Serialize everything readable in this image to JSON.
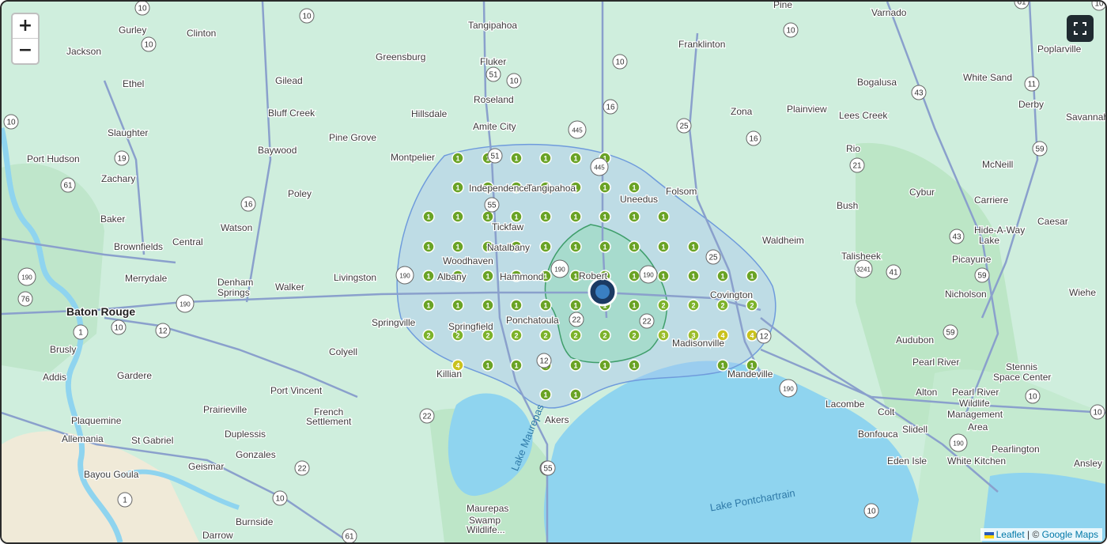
{
  "controls": {
    "zoom_in": "+",
    "zoom_out": "−",
    "fullscreen_icon": "fullscreen-icon"
  },
  "attribution": {
    "leaflet": "Leaflet",
    "separator": " | © ",
    "provider": "Google Maps"
  },
  "colors": {
    "land": "#cfeedd",
    "water": "#8fd4ef",
    "road": "#8aa0cc",
    "outer_zone": "#a9c6ef",
    "inner_zone": "#7fd9a0",
    "marker": "#6aa325"
  },
  "places": [
    {
      "name": "Gurley",
      "bold": false
    },
    {
      "name": "Clinton",
      "bold": false
    },
    {
      "name": "Jackson",
      "bold": false
    },
    {
      "name": "Tangipahoa",
      "bold": false
    },
    {
      "name": "Pine",
      "bold": false
    },
    {
      "name": "Varnado",
      "bold": false
    },
    {
      "name": "Greensburg",
      "bold": false
    },
    {
      "name": "Fluker",
      "bold": false
    },
    {
      "name": "Franklinton",
      "bold": false
    },
    {
      "name": "Poplarville",
      "bold": false
    },
    {
      "name": "Ethel",
      "bold": false
    },
    {
      "name": "Gilead",
      "bold": false
    },
    {
      "name": "White Sand",
      "bold": false
    },
    {
      "name": "Bogalusa",
      "bold": false
    },
    {
      "name": "Roseland",
      "bold": false
    },
    {
      "name": "Derby",
      "bold": false
    },
    {
      "name": "Bluff Creek",
      "bold": false
    },
    {
      "name": "Hillsdale",
      "bold": false
    },
    {
      "name": "Zona",
      "bold": false
    },
    {
      "name": "Plainview",
      "bold": false
    },
    {
      "name": "Lees Creek",
      "bold": false
    },
    {
      "name": "Savannah",
      "bold": false
    },
    {
      "name": "Amite City",
      "bold": false
    },
    {
      "name": "Slaughter",
      "bold": false
    },
    {
      "name": "Pine Grove",
      "bold": false
    },
    {
      "name": "Baywood",
      "bold": false
    },
    {
      "name": "Rio",
      "bold": false
    },
    {
      "name": "McNeill",
      "bold": false
    },
    {
      "name": "Port Hudson",
      "bold": false
    },
    {
      "name": "Montpelier",
      "bold": false
    },
    {
      "name": "Zachary",
      "bold": false
    },
    {
      "name": "Independence",
      "bold": false
    },
    {
      "name": "Tangipahoa",
      "bold": false
    },
    {
      "name": "Folsom",
      "bold": false
    },
    {
      "name": "Cybur",
      "bold": false
    },
    {
      "name": "Poley",
      "bold": false
    },
    {
      "name": "Uneedus",
      "bold": false
    },
    {
      "name": "Carriere",
      "bold": false
    },
    {
      "name": "Bush",
      "bold": false
    },
    {
      "name": "Baker",
      "bold": false
    },
    {
      "name": "Watson",
      "bold": false
    },
    {
      "name": "Tickfaw",
      "bold": false
    },
    {
      "name": "Caesar",
      "bold": false
    },
    {
      "name": "Hide-A-Way",
      "bold": false
    },
    {
      "name": "Lake",
      "bold": false
    },
    {
      "name": "Central",
      "bold": false
    },
    {
      "name": "Waldheim",
      "bold": false
    },
    {
      "name": "Brownfields",
      "bold": false
    },
    {
      "name": "Natalbany",
      "bold": false
    },
    {
      "name": "Talisheek",
      "bold": false
    },
    {
      "name": "Picayune",
      "bold": false
    },
    {
      "name": "Woodhaven",
      "bold": false
    },
    {
      "name": "Merrydale",
      "bold": false
    },
    {
      "name": "Livingston",
      "bold": false
    },
    {
      "name": "Albany",
      "bold": false
    },
    {
      "name": "Hammond",
      "bold": false
    },
    {
      "name": "Robert",
      "bold": false
    },
    {
      "name": "Denham",
      "bold": false
    },
    {
      "name": "Springs",
      "bold": false
    },
    {
      "name": "Walker",
      "bold": false
    },
    {
      "name": "Covington",
      "bold": false
    },
    {
      "name": "Nicholson",
      "bold": false
    },
    {
      "name": "Wiehe",
      "bold": false
    },
    {
      "name": "Baton Rouge",
      "bold": true
    },
    {
      "name": "Ponchatoula",
      "bold": false
    },
    {
      "name": "Springville",
      "bold": false
    },
    {
      "name": "Springfield",
      "bold": false
    },
    {
      "name": "Madisonville",
      "bold": false
    },
    {
      "name": "Audubon",
      "bold": false
    },
    {
      "name": "Brusly",
      "bold": false
    },
    {
      "name": "Colyell",
      "bold": false
    },
    {
      "name": "Pearl River",
      "bold": false
    },
    {
      "name": "Stennis",
      "bold": false
    },
    {
      "name": "Space Center",
      "bold": false
    },
    {
      "name": "Addis",
      "bold": false
    },
    {
      "name": "Gardere",
      "bold": false
    },
    {
      "name": "Killian",
      "bold": false
    },
    {
      "name": "Mandeville",
      "bold": false
    },
    {
      "name": "Port Vincent",
      "bold": false
    },
    {
      "name": "Alton",
      "bold": false
    },
    {
      "name": "Pearl River",
      "bold": false
    },
    {
      "name": "Wildlife",
      "bold": false
    },
    {
      "name": "Management",
      "bold": false
    },
    {
      "name": "Area",
      "bold": false
    },
    {
      "name": "Prairieville",
      "bold": false
    },
    {
      "name": "Lacombe",
      "bold": false
    },
    {
      "name": "Colt",
      "bold": false
    },
    {
      "name": "French",
      "bold": false
    },
    {
      "name": "Settlement",
      "bold": false
    },
    {
      "name": "Akers",
      "bold": false
    },
    {
      "name": "Plaquemine",
      "bold": false
    },
    {
      "name": "Duplessis",
      "bold": false
    },
    {
      "name": "Slidell",
      "bold": false
    },
    {
      "name": "Bonfouca",
      "bold": false
    },
    {
      "name": "Allemania",
      "bold": false
    },
    {
      "name": "St Gabriel",
      "bold": false
    },
    {
      "name": "Pearlington",
      "bold": false
    },
    {
      "name": "Gonzales",
      "bold": false
    },
    {
      "name": "Eden Isle",
      "bold": false
    },
    {
      "name": "White Kitchen",
      "bold": false
    },
    {
      "name": "Ansley",
      "bold": false
    },
    {
      "name": "Geismar",
      "bold": false
    },
    {
      "name": "Bayou Goula",
      "bold": false
    },
    {
      "name": "Maurepas",
      "bold": false
    },
    {
      "name": "Swamp",
      "bold": false
    },
    {
      "name": "Wildlife...",
      "bold": false
    },
    {
      "name": "Burnside",
      "bold": false
    },
    {
      "name": "Darrow",
      "bold": false
    }
  ],
  "water_labels": [
    "Lake Maurepas",
    "Lake Pontchartrain"
  ],
  "route_shields": [
    "10",
    "10",
    "10",
    "10",
    "19",
    "61",
    "16",
    "190",
    "76",
    "190",
    "12",
    "10",
    "1",
    "61",
    "51",
    "10",
    "10",
    "445",
    "16",
    "25",
    "16",
    "51",
    "445",
    "55",
    "190",
    "22",
    "55",
    "22",
    "25",
    "190",
    "12",
    "3241",
    "41",
    "43",
    "11",
    "21",
    "59",
    "43",
    "59",
    "10",
    "59",
    "190",
    "10",
    "22",
    "1",
    "22",
    "10",
    "12",
    "55",
    "61",
    "10",
    "190",
    "10",
    "10",
    "190"
  ],
  "marker_counts": [
    1,
    1,
    1,
    1,
    1,
    1,
    1,
    1,
    1,
    1,
    1,
    1,
    1,
    1,
    1,
    1,
    1,
    1,
    1,
    1,
    1,
    1,
    1,
    1,
    1,
    1,
    1,
    1,
    1,
    1,
    1,
    1,
    1,
    1,
    1,
    1,
    1,
    1,
    1,
    1,
    1,
    1,
    1,
    1,
    1,
    1,
    1,
    1,
    1,
    1,
    1,
    1,
    2,
    2,
    2,
    2,
    2,
    2,
    2,
    2,
    2,
    2,
    2,
    2,
    3,
    3,
    4,
    4,
    4,
    1,
    1,
    1,
    1,
    1,
    1,
    1,
    1,
    1,
    1,
    1,
    1
  ],
  "center_marker": "location-center-marker"
}
